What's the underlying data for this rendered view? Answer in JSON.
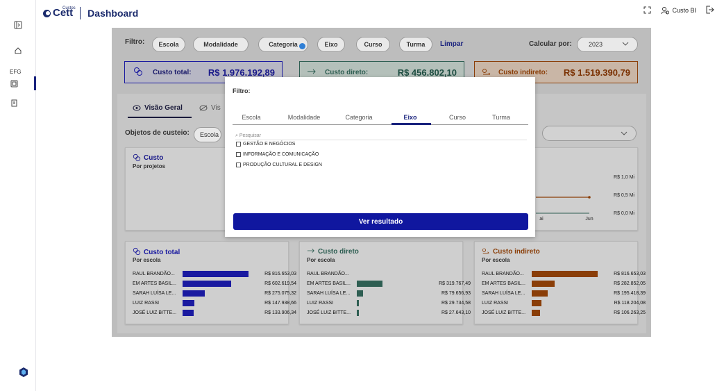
{
  "header": {
    "brand_sup": "Custos",
    "brand": "Cett",
    "title": "Dashboard",
    "user": "Custo BI"
  },
  "sidebar": {
    "efg_label": "EFG"
  },
  "filter_bar": {
    "label": "Filtro:",
    "pills": [
      "Escola",
      "Modalidade",
      "Categoria",
      "Eixo",
      "Curso",
      "Turma"
    ],
    "clear": "Limpar",
    "calc_label": "Calcular por:",
    "year": "2023"
  },
  "kpis": {
    "total_label": "Custo total:",
    "total_value": "R$ 1.976.192,89",
    "direct_label": "Custo direto:",
    "direct_value": "R$ 456.802,10",
    "indirect_label": "Custo indireto:",
    "indirect_value": "R$ 1.519.390,79"
  },
  "view_tabs": {
    "overview": "Visão Geral",
    "second": "Vis"
  },
  "objects": {
    "label": "Objetos de custeio:",
    "value": "Escola"
  },
  "cost_panel": {
    "title": "Custo",
    "subtitle": "Por projetos"
  },
  "line_panel": {
    "y_ticks": [
      "R$ 1,0 Mi",
      "R$ 0,5 Mi",
      "R$ 0,0 Mi"
    ],
    "x_ticks": [
      "ai",
      "Jun"
    ]
  },
  "bar_panels": [
    {
      "title": "Custo total",
      "subtitle": "Por escola",
      "color": "#1a1aa0",
      "rows": [
        {
          "label": "RAUL BRANDÃO...",
          "value": "R$ 816.653,03",
          "num": 816653.03
        },
        {
          "label": "EM ARTES BASIL...",
          "value": "R$ 602.619,54",
          "num": 602619.54
        },
        {
          "label": "SARAH LUÍSA LE...",
          "value": "R$ 275.075,32",
          "num": 275075.32
        },
        {
          "label": "LUIZ RASSI",
          "value": "R$ 147.938,66",
          "num": 147938.66
        },
        {
          "label": "JOSÉ LUIZ BITTE...",
          "value": "R$ 133.906,34",
          "num": 133906.34
        }
      ]
    },
    {
      "title": "Custo direto",
      "subtitle": "Por escola",
      "color": "#2e5e52",
      "rows": [
        {
          "label": "RAUL BRANDÃO...",
          "value": "",
          "num": 0
        },
        {
          "label": "EM ARTES BASIL...",
          "value": "R$ 319.767,49",
          "num": 319767.49
        },
        {
          "label": "SARAH LUÍSA LE...",
          "value": "R$ 79.656,93",
          "num": 79656.93
        },
        {
          "label": "LUIZ RASSI",
          "value": "R$ 29.734,58",
          "num": 29734.58
        },
        {
          "label": "JOSÉ LUIZ BITTE...",
          "value": "R$ 27.643,10",
          "num": 27643.1
        }
      ]
    },
    {
      "title": "Custo indireto",
      "subtitle": "Por escola",
      "color": "#8a3e08",
      "rows": [
        {
          "label": "RAUL BRANDÃO...",
          "value": "R$ 816.653,03",
          "num": 816653.03
        },
        {
          "label": "EM ARTES BASIL...",
          "value": "R$ 282.852,05",
          "num": 282852.05
        },
        {
          "label": "SARAH LUÍSA LE...",
          "value": "R$ 195.418,39",
          "num": 195418.39
        },
        {
          "label": "LUIZ RASSI",
          "value": "R$ 118.204,08",
          "num": 118204.08
        },
        {
          "label": "JOSÉ LUIZ BITTE...",
          "value": "R$ 106.263,25",
          "num": 106263.25
        }
      ]
    }
  ],
  "modal": {
    "label": "Filtro:",
    "tabs": [
      "Escola",
      "Modalidade",
      "Categoria",
      "Eixo",
      "Curso",
      "Turma"
    ],
    "active_tab": "Eixo",
    "search_placeholder": "Pesquisar",
    "options": [
      "GESTÃO E NEGÓCIOS",
      "INFORMAÇÃO E COMUNICAÇÃO",
      "PRODUÇÃO CULTURAL E DESIGN"
    ],
    "submit": "Ver resultado"
  },
  "colors": {
    "accent": "#1a237e",
    "total": "#1a1aa0",
    "direct": "#2e5e52",
    "indirect": "#8a3e08"
  }
}
